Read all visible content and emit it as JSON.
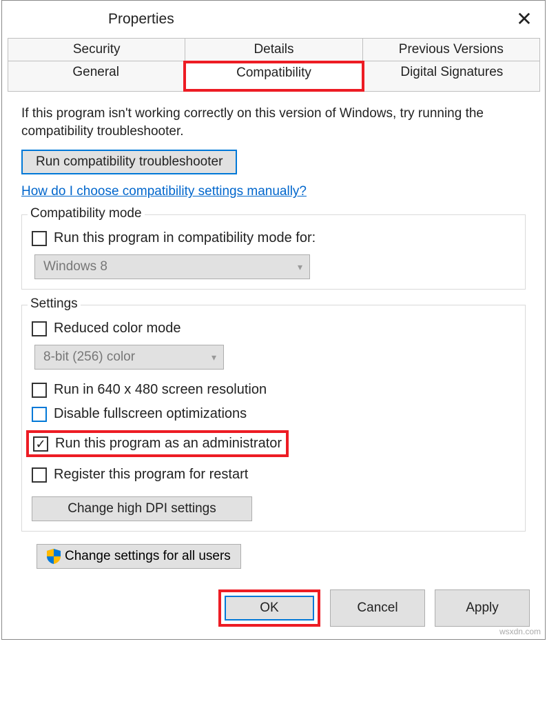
{
  "title": "Properties",
  "tabs": {
    "row1": [
      "Security",
      "Details",
      "Previous Versions"
    ],
    "row2": [
      "General",
      "Compatibility",
      "Digital Signatures"
    ]
  },
  "intro": "If this program isn't working correctly on this version of Windows, try running the compatibility troubleshooter.",
  "troubleshooter_btn": "Run compatibility troubleshooter",
  "help_link": "How do I choose compatibility settings manually?",
  "compat_mode": {
    "title": "Compatibility mode",
    "checkbox": "Run this program in compatibility mode for:",
    "select": "Windows 8"
  },
  "settings": {
    "title": "Settings",
    "reduced_color": "Reduced color mode",
    "color_select": "8-bit (256) color",
    "run640": "Run in 640 x 480 screen resolution",
    "disable_fullscreen": "Disable fullscreen optimizations",
    "run_admin": "Run this program as an administrator",
    "register_restart": "Register this program for restart",
    "dpi_btn": "Change high DPI settings"
  },
  "all_users_btn": "Change settings for all users",
  "footer": {
    "ok": "OK",
    "cancel": "Cancel",
    "apply": "Apply"
  },
  "watermark": "wsxdn.com"
}
